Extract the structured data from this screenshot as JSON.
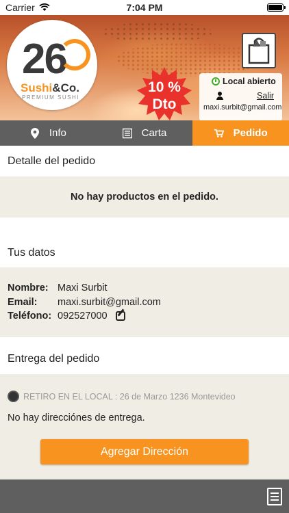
{
  "status_bar": {
    "carrier": "Carrier",
    "time": "7:04 PM"
  },
  "brand": {
    "number": "26",
    "name_part1": "Sushi",
    "name_part2": "&Co.",
    "tagline": "PREMIUM SUSHI"
  },
  "promo": {
    "line1": "10 %",
    "line2": "Dto"
  },
  "store_status": {
    "label": "Local abierto",
    "logout": "Salir",
    "user_email": "maxi.surbit@gmail.com"
  },
  "tabs": [
    {
      "label": "Info",
      "icon": "map-pin-icon",
      "active": false
    },
    {
      "label": "Carta",
      "icon": "menu-list-icon",
      "active": false
    },
    {
      "label": "Pedido",
      "icon": "cart-icon",
      "active": true
    }
  ],
  "order": {
    "title": "Detalle del pedido",
    "empty_message": "No hay productos en el pedido."
  },
  "customer": {
    "title": "Tus datos",
    "name_label": "Nombre:",
    "name_value": "Maxi Surbit",
    "email_label": "Email:",
    "email_value": "maxi.surbit@gmail.com",
    "phone_label": "Teléfono:",
    "phone_value": "092527000"
  },
  "delivery": {
    "title": "Entrega del pedido",
    "pickup_option": "RETIRO EN EL LOCAL : 26 de Marzo 1236 Montevideo",
    "no_addresses": "No hay direcciónes de entrega.",
    "add_button": "Agregar Dirección"
  },
  "colors": {
    "accent": "#f7931e",
    "tab_bg": "#5f5f5f",
    "panel_bg": "#f0ede4",
    "open_green": "#3fae2a",
    "promo_red": "#e8322b"
  }
}
